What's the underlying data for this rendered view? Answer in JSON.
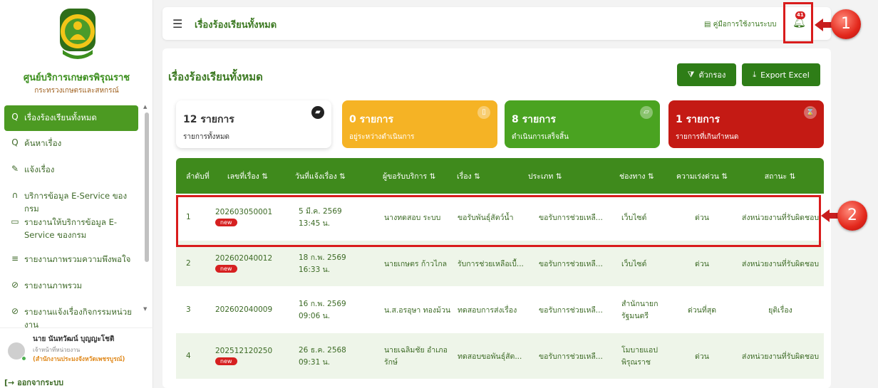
{
  "sidebar": {
    "brand_title": "ศูนย์บริการเกษตรพิรุณราช",
    "brand_sub": "กระทรวงเกษตรและสหกรณ์",
    "items": [
      {
        "icon": "search-icon",
        "glyph": "Q",
        "label": "เรื่องร้องเรียนทั้งหมด"
      },
      {
        "icon": "search-icon",
        "glyph": "Q",
        "label": "ค้นหาเรื่อง"
      },
      {
        "icon": "edit-icon",
        "glyph": "✎",
        "label": "แจ้งเรื่อง"
      },
      {
        "icon": "headset-icon",
        "glyph": "∩",
        "label": "บริการข้อมูล E-Service ของกรม"
      },
      {
        "icon": "monitor-icon",
        "glyph": "▭",
        "label": "รายงานให้บริการข้อมูล E-Service ของกรม"
      },
      {
        "icon": "list-icon",
        "glyph": "≡",
        "label": "รายงานภาพรวมความพึงพอใจ"
      },
      {
        "icon": "chart-icon",
        "glyph": "⊘",
        "label": "รายงานภาพรวม"
      },
      {
        "icon": "chart-icon",
        "glyph": "⊘",
        "label": "รายงานแจ้งเรื่องกิจกรรมหน่วยงาน"
      }
    ],
    "user": {
      "name": "นาย นันทวัฒน์ บุญญะโชติ",
      "role": "เจ้าหน้าที่หน่วยงาน",
      "org": "(สำนักงานประมงจังหวัดเพชรบูรณ์)"
    },
    "logout": "ออกจากระบบ"
  },
  "header": {
    "title": "เรื่องร้องเรียนทั้งหมด",
    "manual": "คู่มือการใช้งานระบบ",
    "bell_count": "41"
  },
  "page": {
    "title": "เรื่องร้องเรียนทั้งหมด",
    "filter_button": "ตัวกรอง",
    "export_button": "Export Excel"
  },
  "cards": {
    "all": {
      "count": "12 รายการ",
      "label": "รายการทั้งหมด"
    },
    "pending": {
      "count": "0 รายการ",
      "label": "อยู่ระหว่างดำเนินการ"
    },
    "done": {
      "count": "8 รายการ",
      "label": "ดำเนินการเสร็จสิ้น"
    },
    "late": {
      "count": "1 รายการ",
      "label": "รายการที่เกินกำหนด"
    }
  },
  "table": {
    "headers": [
      "ลำดับที่",
      "เลขที่เรื่อง ⇅",
      "วันที่แจ้งเรื่อง ⇅",
      "ผู้ขอรับบริการ ⇅",
      "เรื่อง ⇅",
      "ประเภท ⇅",
      "ช่องทาง ⇅",
      "ความเร่งด่วน ⇅",
      "สถานะ ⇅"
    ],
    "rows": [
      {
        "no": "1",
        "id": "202603050001",
        "new": "new",
        "date": "5 มี.ค. 2569",
        "time": "13:45 น.",
        "requester": "นางทดสอบ ระบบ",
        "subject": "ขอรับพันธุ์สัตว์น้ำ",
        "type": "ขอรับการช่วยเหลื...",
        "channel": "เว็บไซต์",
        "urgency": "ด่วน",
        "status": "ส่งหน่วยงานที่รับผิดชอบ"
      },
      {
        "no": "2",
        "id": "202602040012",
        "new": "new",
        "date": "18 ก.พ. 2569",
        "time": "16:33 น.",
        "requester": "นายเกษตร ก้าวไกล",
        "subject": "รับการช่วยเหลือเบื้...",
        "type": "ขอรับการช่วยเหลื...",
        "channel": "เว็บไซต์",
        "urgency": "ด่วน",
        "status": "ส่งหน่วยงานที่รับผิดชอบ"
      },
      {
        "no": "3",
        "id": "202602040009",
        "new": "",
        "date": "16 ก.พ. 2569",
        "time": "09:06 น.",
        "requester": "น.ส.อรอุษา ทองม้วน",
        "subject": "ทดสอบการส่งเรื่อง",
        "type": "ขอรับการช่วยเหลื...",
        "channel": "สำนักนายกรัฐมนตรี",
        "urgency": "ด่วนที่สุด",
        "status": "ยุติเรื่อง"
      },
      {
        "no": "4",
        "id": "202512120250",
        "new": "new",
        "date": "26 ธ.ค. 2568",
        "time": "09:31 น.",
        "requester": "นายเฉลิมชัย อำเภอรักษ์",
        "subject": "ทดสอบขอพันธุ์สัต...",
        "type": "ขอรับการช่วยเหลื...",
        "channel": "โมบายแอปพิรุณราช",
        "urgency": "ด่วน",
        "status": "ส่งหน่วยงานที่รับผิดชอบ"
      }
    ]
  },
  "annotations": {
    "marker1": "1",
    "marker2": "2"
  },
  "colors": {
    "primary": "#3f8a1c",
    "pending": "#f5b325",
    "done": "#4aa321",
    "late": "#c41a14",
    "highlight": "#d91c1c"
  }
}
